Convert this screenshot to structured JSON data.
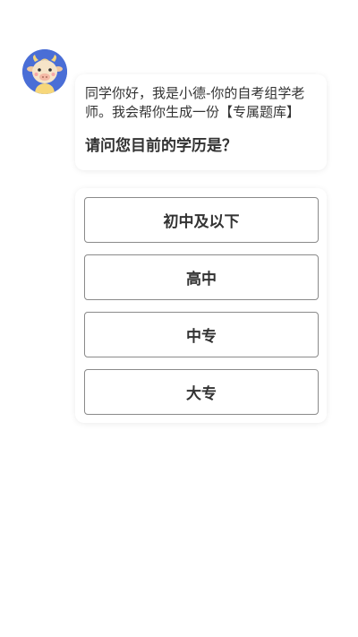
{
  "chat": {
    "avatar_icon": "cow-mascot-icon",
    "greeting": "同学你好，我是小德-你的自考组学老师。我会帮你生成一份【专属题库】",
    "question": "请问您目前的学历是？"
  },
  "options": [
    {
      "label": "初中及以下"
    },
    {
      "label": "高中"
    },
    {
      "label": "中专"
    },
    {
      "label": "大专"
    }
  ],
  "colors": {
    "avatar_bg": "#4a6ed6",
    "text": "#333333",
    "option_border": "#8a8a8a"
  }
}
